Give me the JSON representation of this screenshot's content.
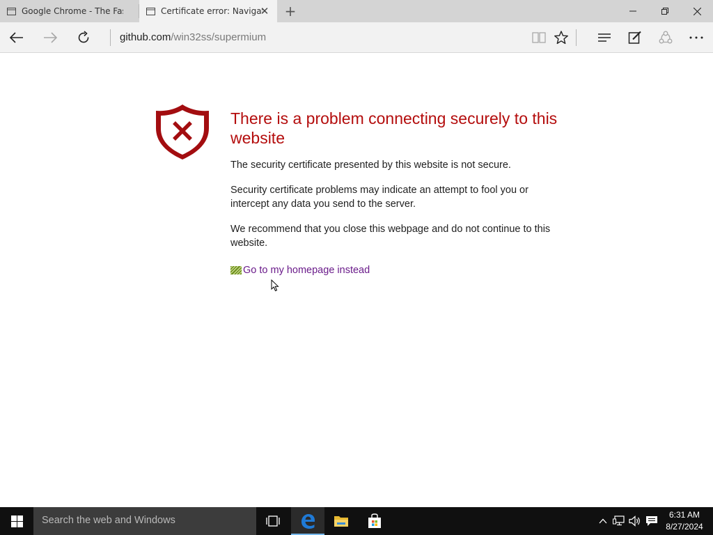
{
  "browser": {
    "tabs": [
      {
        "label": "Google Chrome - The Fast &",
        "active": false
      },
      {
        "label": "Certificate error: Navigat",
        "active": true
      }
    ],
    "new_tab_symbol": "+",
    "address": {
      "host": "github.com",
      "path": "/win32ss/supermium"
    },
    "icons": {
      "back": "back-arrow-icon",
      "forward": "forward-arrow-icon",
      "refresh": "refresh-icon",
      "reading_view": "reading-view-icon",
      "favorite": "star-icon",
      "hub": "hub-icon",
      "web_note": "web-note-icon",
      "share": "share-icon",
      "more": "more-icon"
    }
  },
  "error_page": {
    "title": "There is a problem connecting securely to this website",
    "paragraphs": [
      "The security certificate presented by this website is not secure.",
      "Security certificate problems may indicate an attempt to fool you or intercept any data you send to the server.",
      "We recommend that you close this webpage and do not continue to this website."
    ],
    "homepage_link": "Go to my homepage instead",
    "accent_color": "#b40d0d",
    "link_color": "#6a1b8a"
  },
  "taskbar": {
    "search_placeholder": "Search the web and Windows",
    "clock_time": "6:31 AM",
    "clock_date": "8/27/2024",
    "apps": [
      "task-view-icon",
      "edge-icon",
      "file-explorer-icon",
      "store-icon"
    ],
    "tray": [
      "chevron-up-icon",
      "network-icon",
      "volume-icon",
      "notification-icon"
    ]
  }
}
